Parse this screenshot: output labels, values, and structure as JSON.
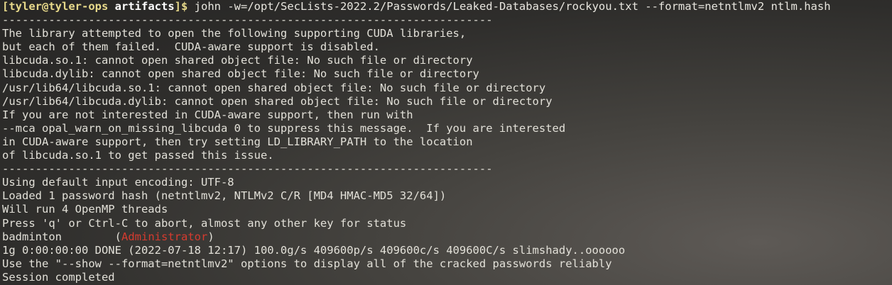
{
  "prompt": {
    "open": "[",
    "user_host": "tyler@tyler-ops",
    "dir": "artifacts",
    "close": "]$",
    "command": " john -w=/opt/SecLists-2022.2/Passwords/Leaked-Databases/rockyou.txt --format=netntlmv2 ntlm.hash"
  },
  "output": {
    "separator": "--------------------------------------------------------------------------",
    "cuda_warning": [
      "The library attempted to open the following supporting CUDA libraries,",
      "but each of them failed.  CUDA-aware support is disabled.",
      "libcuda.so.1: cannot open shared object file: No such file or directory",
      "libcuda.dylib: cannot open shared object file: No such file or directory",
      "/usr/lib64/libcuda.so.1: cannot open shared object file: No such file or directory",
      "/usr/lib64/libcuda.dylib: cannot open shared object file: No such file or directory",
      "If you are not interested in CUDA-aware support, then run with",
      "--mca opal_warn_on_missing_libcuda 0 to suppress this message.  If you are interested",
      "in CUDA-aware support, then try setting LD_LIBRARY_PATH to the location",
      "of libcuda.so.1 to get passed this issue."
    ],
    "run_info": [
      "Using default input encoding: UTF-8",
      "Loaded 1 password hash (netntlmv2, NTLMv2 C/R [MD4 HMAC-MD5 32/64])",
      "Will run 4 OpenMP threads",
      "Press 'q' or Ctrl-C to abort, almost any other key for status"
    ],
    "cracked": {
      "password": "badminton",
      "spacer": "        ",
      "paren_open": "(",
      "username": "Administrator",
      "paren_close": ")"
    },
    "summary": [
      "1g 0:00:00:00 DONE (2022-07-18 12:17) 100.0g/s 409600p/s 409600c/s 409600C/s slimshady..oooooo",
      "Use the \"--show --format=netntlmv2\" options to display all of the cracked passwords reliably",
      "Session completed"
    ]
  },
  "colors": {
    "prompt": "#e7d98a",
    "highlight_red": "#d53b2f",
    "text": "#e2e0d8"
  }
}
